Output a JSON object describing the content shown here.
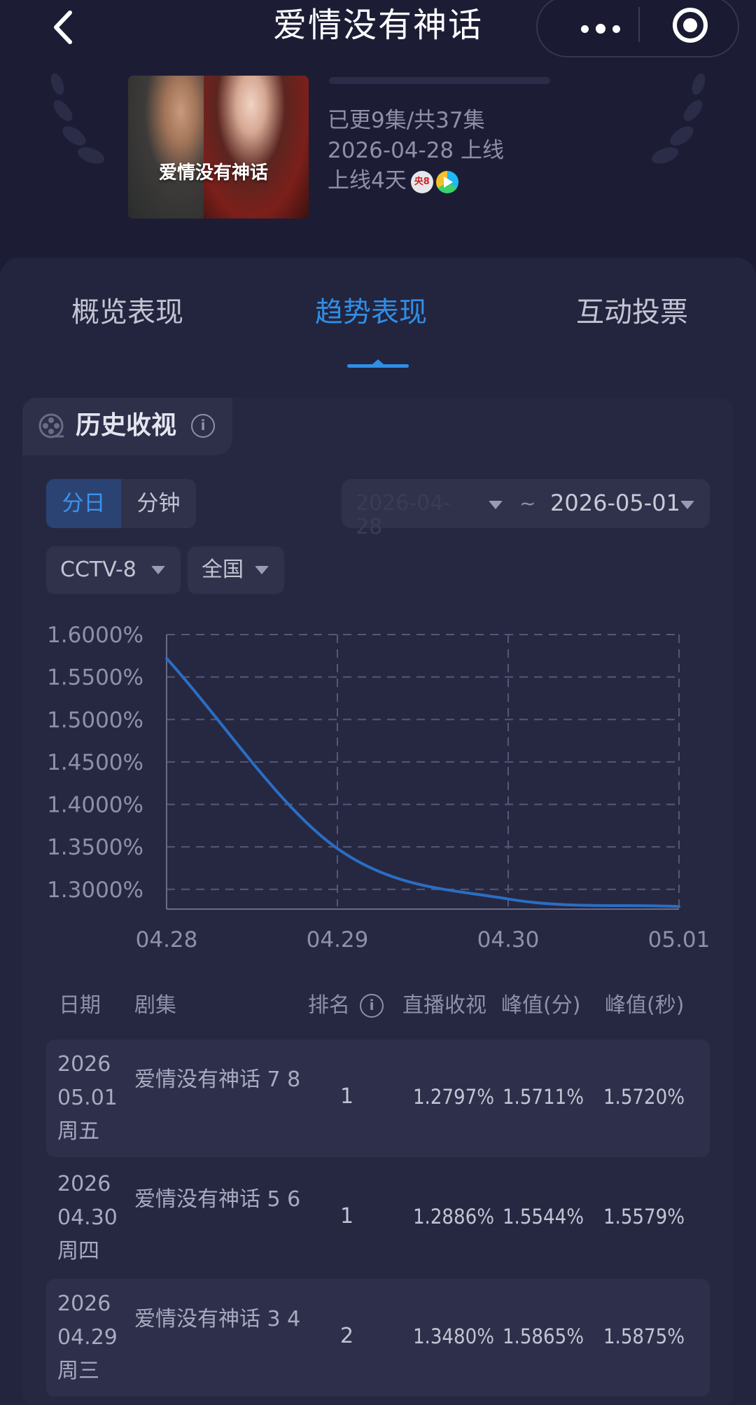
{
  "header": {
    "title": "爱情没有神话"
  },
  "show": {
    "episodes": "已更9集/共37集",
    "premiere": "2026-04-28 上线",
    "days_online": "上线4天",
    "channel_badge": "央8",
    "poster_title": "爱情没有神话"
  },
  "tabs": [
    {
      "label": "概览表现",
      "active": false
    },
    {
      "label": "趋势表现",
      "active": true
    },
    {
      "label": "互动投票",
      "active": false
    }
  ],
  "section": {
    "title": "历史收视"
  },
  "granularity": {
    "day": "分日",
    "minute": "分钟",
    "selected": "分日"
  },
  "date_range": {
    "start": "2026-04-28",
    "separator": "~",
    "end": "2026-05-01"
  },
  "filters": {
    "channel": "CCTV-8",
    "region": "全国"
  },
  "colors": {
    "accent": "#2f8ee6",
    "line": "#2a6ec4",
    "background": "#1c1d35",
    "card": "#23243e"
  },
  "chart_data": {
    "type": "line",
    "x": [
      "04.28",
      "04.29",
      "04.30",
      "05.01"
    ],
    "series": [
      {
        "values": [
          1.572,
          1.348,
          1.2886,
          1.2797
        ]
      }
    ],
    "y_ticks": [
      "1.6000%",
      "1.5500%",
      "1.5000%",
      "1.4500%",
      "1.4000%",
      "1.3500%",
      "1.3000%"
    ],
    "ylim": [
      1.28,
      1.6
    ],
    "grid": true,
    "smooth": true
  },
  "table": {
    "headers": [
      "日期",
      "剧集",
      "排名",
      "直播收视",
      "峰值(分)",
      "峰值(秒)"
    ],
    "rows": [
      {
        "year": "2026",
        "date": "05.01",
        "weekday": "周五",
        "episode": "爱情没有神话 7 8",
        "rank": "1",
        "live": "1.2797%",
        "peak_min": "1.5711%",
        "peak_sec": "1.5720%"
      },
      {
        "year": "2026",
        "date": "04.30",
        "weekday": "周四",
        "episode": "爱情没有神话 5 6",
        "rank": "1",
        "live": "1.2886%",
        "peak_min": "1.5544%",
        "peak_sec": "1.5579%"
      },
      {
        "year": "2026",
        "date": "04.29",
        "weekday": "周三",
        "episode": "爱情没有神话 3 4",
        "rank": "2",
        "live": "1.3480%",
        "peak_min": "1.5865%",
        "peak_sec": "1.5875%"
      }
    ]
  }
}
